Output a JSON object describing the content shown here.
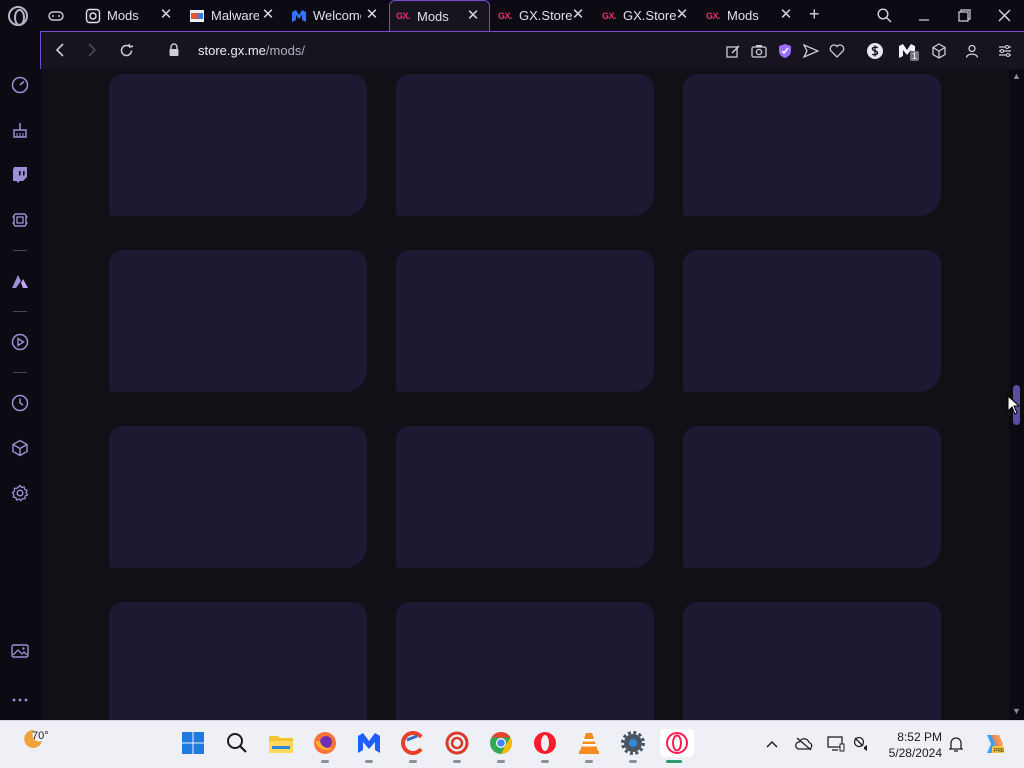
{
  "tabs": [
    {
      "title": "Mods",
      "icon": "gear-icon",
      "active": false
    },
    {
      "title": "Malware",
      "icon": "malwarebytes-icon",
      "active": false
    },
    {
      "title": "Welcome",
      "icon": "malwarebytes-m-icon",
      "active": false
    },
    {
      "title": "Mods",
      "icon": "gx-icon",
      "active": true
    },
    {
      "title": "GX.Store",
      "icon": "gx-icon",
      "active": false
    },
    {
      "title": "GX.Store",
      "icon": "gx-icon",
      "active": false
    },
    {
      "title": "Mods",
      "icon": "gx-icon",
      "active": false
    }
  ],
  "tab_brand": "GX.",
  "tab_close_glyph": "✕",
  "new_tab_glyph": "+",
  "address": {
    "host": "store.gx.me",
    "path": "/mods/"
  },
  "extensions": {
    "badge_count": "1"
  },
  "mods_grid": {
    "columns": 3,
    "rows": 4,
    "card_color": "#1c1932",
    "background_color": "#111016"
  },
  "taskbar": {
    "temperature": "70°",
    "time": "8:52 PM",
    "date": "5/28/2024"
  },
  "colors": {
    "accent": "#7c49d6",
    "gx_red": "#e8336a",
    "sidebar_icon": "#9b8fd6"
  }
}
